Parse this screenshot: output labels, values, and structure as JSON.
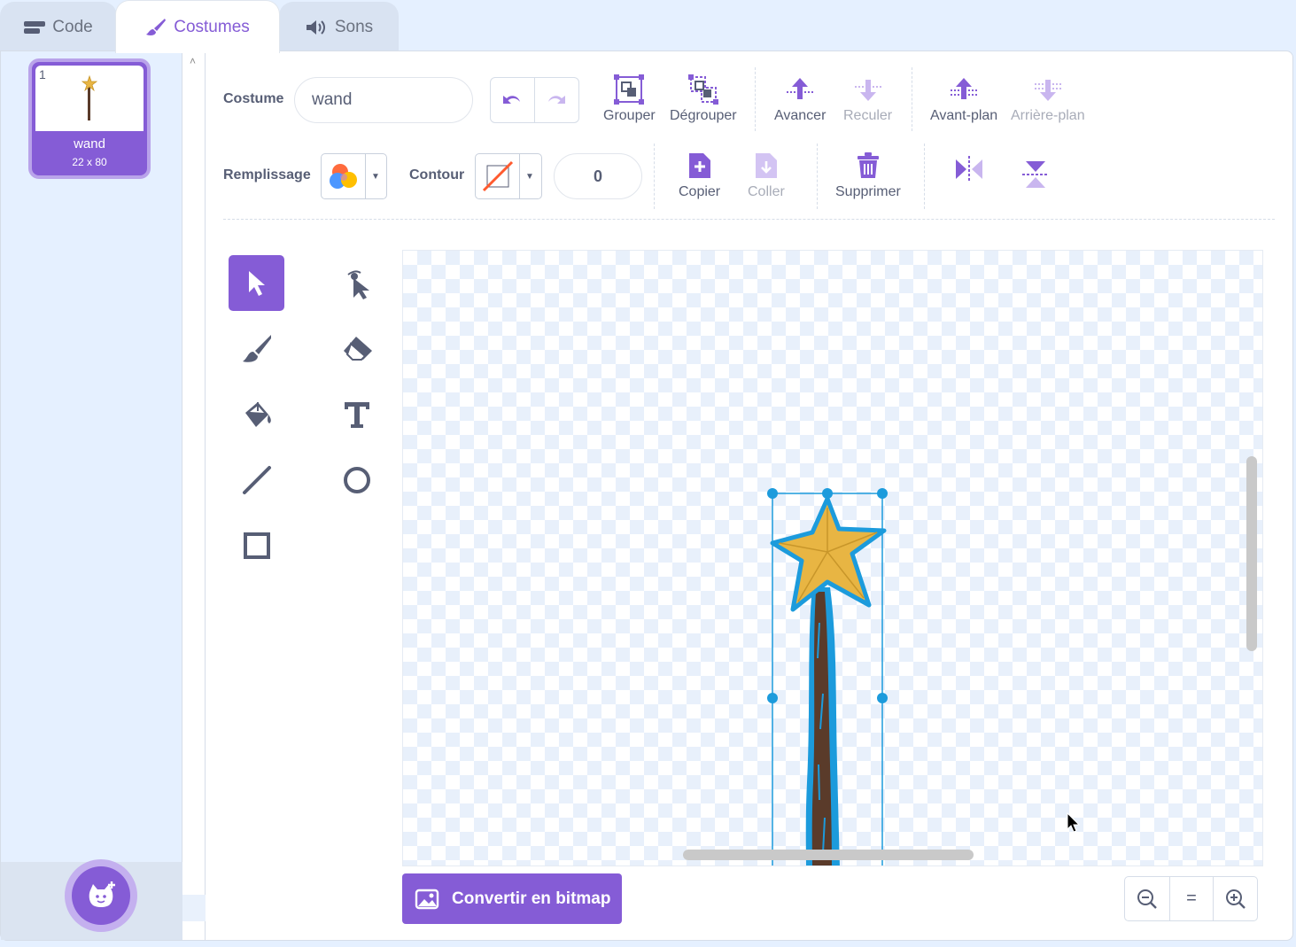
{
  "tabs": [
    {
      "label": "Code",
      "icon": "code-icon"
    },
    {
      "label": "Costumes",
      "icon": "brush-icon"
    },
    {
      "label": "Sons",
      "icon": "speaker-icon"
    }
  ],
  "costumes": [
    {
      "number": "1",
      "name": "wand",
      "size": "22 x 80"
    }
  ],
  "toolbar": {
    "costume_label": "Costume",
    "costume_name": "wand",
    "group": "Grouper",
    "ungroup": "Dégrouper",
    "forward": "Avancer",
    "backward": "Reculer",
    "front": "Avant-plan",
    "back": "Arrière-plan",
    "fill_label": "Remplissage",
    "outline_label": "Contour",
    "outline_width": "0",
    "copy": "Copier",
    "paste": "Coller",
    "delete": "Supprimer"
  },
  "tools": [
    "select",
    "reshape",
    "brush",
    "eraser",
    "fill",
    "text",
    "line",
    "circle",
    "rectangle"
  ],
  "active_tool": "select",
  "convert_button": "Convertir en bitmap",
  "zoom": {
    "out": "zoom-out-icon",
    "reset": "=",
    "in": "zoom-in-icon"
  },
  "colors": {
    "accent": "#855cd6",
    "selection": "#1c9bdc",
    "star": "#e8b543",
    "wand": "#5a3b2a"
  }
}
